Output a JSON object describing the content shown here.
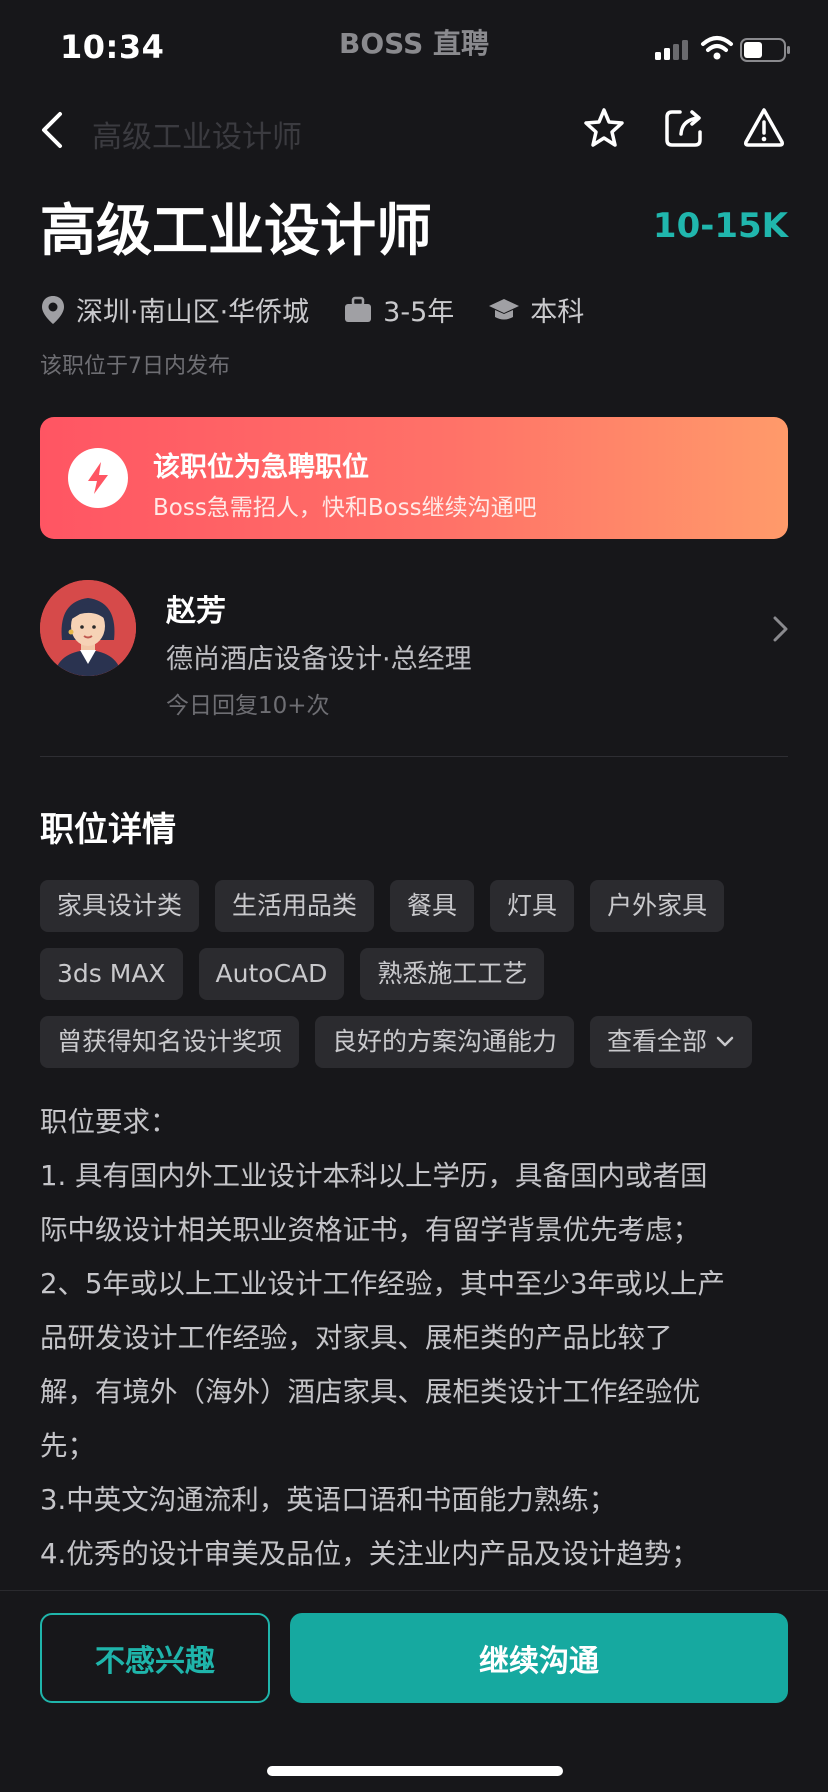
{
  "status_bar": {
    "time": "10:34",
    "app_name": "BOSS 直聘"
  },
  "nav": {
    "title": "高级工业设计师"
  },
  "job": {
    "title": "高级工业设计师",
    "salary": "10-15K",
    "location": "深圳·南山区·华侨城",
    "experience": "3-5年",
    "education": "本科",
    "posted": "该职位于7日内发布"
  },
  "urgent": {
    "title": "该职位为急聘职位",
    "subtitle": "Boss急需招人，快和Boss继续沟通吧"
  },
  "boss": {
    "name": "赵芳",
    "company": "德尚酒店设备设计·总经理",
    "reply": "今日回复10+次"
  },
  "details": {
    "section_title": "职位详情",
    "tag_rows": [
      [
        "家具设计类",
        "生活用品类",
        "餐具",
        "灯具",
        "户外家具"
      ],
      [
        "3ds MAX",
        "AutoCAD",
        "熟悉施工工艺"
      ],
      [
        "曾获得知名设计奖项",
        "良好的方案沟通能力"
      ]
    ],
    "view_all": "查看全部",
    "description_lines": [
      "职位要求：",
      "1. 具有国内外工业设计本科以上学历，具备国内或者国",
      "际中级设计相关职业资格证书，有留学背景优先考虑；",
      "2、5年或以上工业设计工作经验，其中至少3年或以上产",
      "品研发设计工作经验，对家具、展柜类的产品比较了",
      "解，有境外（海外）酒店家具、展柜类设计工作经验优",
      "先；",
      "3.中英文沟通流利，英语口语和书面能力熟练；",
      "4.优秀的设计审美及品位，关注业内产品及设计趋势；"
    ]
  },
  "actions": {
    "not_interested": "不感兴趣",
    "continue_chat": "继续沟通"
  },
  "colors": {
    "accent": "#1fb5ab",
    "background": "#17171a",
    "urgent_start": "#ff5563",
    "urgent_end": "#ff9a6a"
  }
}
